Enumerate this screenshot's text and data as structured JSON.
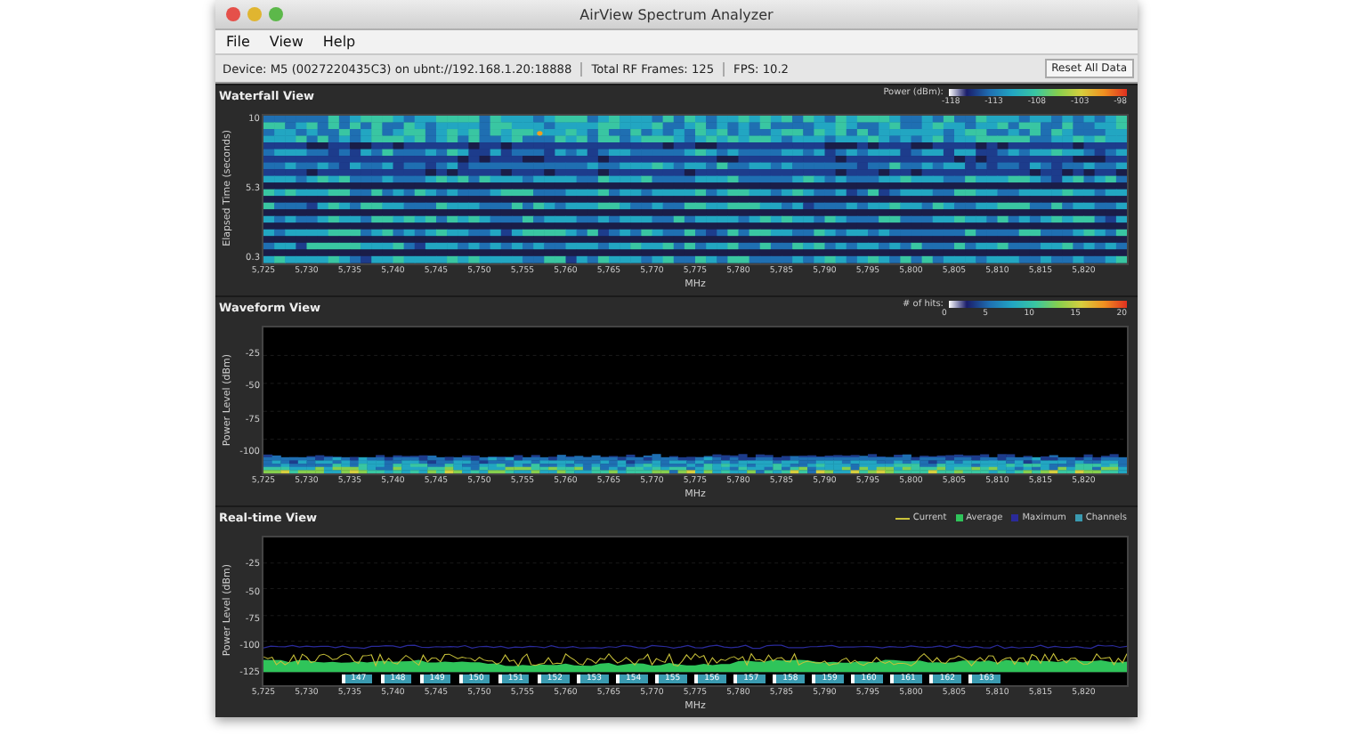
{
  "window": {
    "title": "AirView Spectrum Analyzer"
  },
  "menu": [
    "File",
    "View",
    "Help"
  ],
  "status_bar": {
    "device": "Device: M5 (0027220435C3) on ubnt://192.168.1.20:18888",
    "frames": "Total RF Frames: 125",
    "fps": "FPS: 10.2",
    "reset_button": "Reset All Data"
  },
  "views": [
    {
      "kind": "waterfall",
      "title": "Waterfall View",
      "legend": {
        "label": "Power (dBm):",
        "ticks": [
          "-118",
          "-113",
          "-108",
          "-103",
          "-98"
        ]
      },
      "ylabel": "Elapsed Time (seconds)",
      "yticks": [
        "10",
        "5.3",
        "0.3"
      ],
      "xticks": [
        "5,725",
        "5,730",
        "5,735",
        "5,740",
        "5,745",
        "5,750",
        "5,755",
        "5,760",
        "5,765",
        "5,770",
        "5,775",
        "5,780",
        "5,785",
        "5,790",
        "5,795",
        "5,800",
        "5,805",
        "5,810",
        "5,815",
        "5,820"
      ],
      "xlabel": "MHz"
    },
    {
      "kind": "waveform",
      "title": "Waveform View",
      "legend": {
        "label": "# of hits:",
        "ticks": [
          "0",
          "5",
          "10",
          "15",
          "20"
        ]
      },
      "ylabel": "Power Level (dBm)",
      "yticks": [
        "-25",
        "-50",
        "-75",
        "-100"
      ],
      "xticks": [
        "5,725",
        "5,730",
        "5,735",
        "5,740",
        "5,745",
        "5,750",
        "5,755",
        "5,760",
        "5,765",
        "5,770",
        "5,775",
        "5,780",
        "5,785",
        "5,790",
        "5,795",
        "5,800",
        "5,805",
        "5,810",
        "5,815",
        "5,820"
      ],
      "xlabel": "MHz"
    },
    {
      "kind": "realtime",
      "title": "Real-time View",
      "legend_items": [
        {
          "label": "Current",
          "color": "#c9c23a",
          "kind": "line"
        },
        {
          "label": "Average",
          "color": "#2fc45a",
          "kind": "square"
        },
        {
          "label": "Maximum",
          "color": "#2a2a9a",
          "kind": "square"
        },
        {
          "label": "Channels",
          "color": "#3a9ab0",
          "kind": "square"
        }
      ],
      "ylabel": "Power Level (dBm)",
      "yticks": [
        "-25",
        "-50",
        "-75",
        "-100",
        "-125"
      ],
      "channels": [
        "147",
        "148",
        "149",
        "150",
        "151",
        "152",
        "153",
        "154",
        "155",
        "156",
        "157",
        "158",
        "159",
        "160",
        "161",
        "162",
        "163"
      ],
      "xticks": [
        "5,725",
        "5,730",
        "5,735",
        "5,740",
        "5,745",
        "5,750",
        "5,755",
        "5,760",
        "5,765",
        "5,770",
        "5,775",
        "5,780",
        "5,785",
        "5,790",
        "5,795",
        "5,800",
        "5,805",
        "5,810",
        "5,815",
        "5,820"
      ],
      "xlabel": "MHz"
    }
  ]
}
